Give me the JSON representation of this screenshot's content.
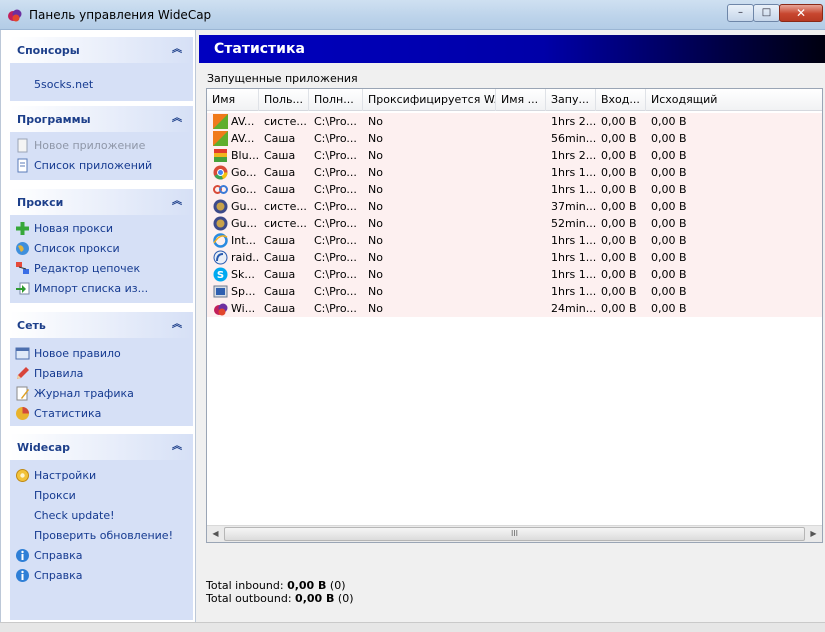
{
  "window": {
    "title": "Панель управления WideCap",
    "min_label": "–",
    "max_label": "□",
    "close_label": "✕"
  },
  "sidebar": {
    "groups": [
      {
        "title": "Спонсоры",
        "items": [
          {
            "label": "5socks.net"
          }
        ]
      },
      {
        "title": "Программы",
        "items": [
          {
            "label": "Новое приложение",
            "icon": "new-app-icon"
          },
          {
            "label": "Список приложений",
            "icon": "app-list-icon"
          }
        ]
      },
      {
        "title": "Прокси",
        "items": [
          {
            "label": "Новая прокси",
            "icon": "plus-icon"
          },
          {
            "label": "Список прокси",
            "icon": "globe-icon"
          },
          {
            "label": "Редактор цепочек",
            "icon": "chain-editor-icon"
          },
          {
            "label": "Импорт списка из...",
            "icon": "import-icon"
          }
        ]
      },
      {
        "title": "Сеть",
        "items": [
          {
            "label": "Новое правило",
            "icon": "new-rule-icon"
          },
          {
            "label": "Правила",
            "icon": "pencil-icon"
          },
          {
            "label": "Журнал трафика",
            "icon": "log-icon"
          },
          {
            "label": "Статистика",
            "icon": "pie-chart-icon"
          }
        ]
      },
      {
        "title": "Widecap",
        "items": [
          {
            "label": "Настройки",
            "icon": "gear-icon"
          },
          {
            "label": "Прокси"
          },
          {
            "label": "Check update!"
          },
          {
            "label": "Проверить обновление!"
          },
          {
            "label": "Справка",
            "icon": "help-icon"
          },
          {
            "label": "Справка",
            "icon": "help-icon"
          }
        ]
      }
    ]
  },
  "main": {
    "title": "Статистика",
    "section_label": "Запущенные приложения",
    "columns": [
      "Имя",
      "Поль...",
      "Полн...",
      "Проксифицируется W...",
      "Имя ...",
      "Запу...",
      "Вход...",
      "Исходящий"
    ],
    "rows": [
      {
        "icon": "avast-icon",
        "cells": [
          "AV...",
          "систе...",
          "C:\\Pro...",
          "No",
          "",
          "1hrs 2...",
          "0,00 B",
          "0,00 B"
        ]
      },
      {
        "icon": "avast-icon",
        "cells": [
          "AV...",
          "Саша",
          "C:\\Pro...",
          "No",
          "",
          "56min...",
          "0,00 B",
          "0,00 B"
        ]
      },
      {
        "icon": "bluestacks-icon",
        "cells": [
          "Blu...",
          "Саша",
          "C:\\Pro...",
          "No",
          "",
          "1hrs 2...",
          "0,00 B",
          "0,00 B"
        ]
      },
      {
        "icon": "chrome-icon",
        "cells": [
          "Go...",
          "Саша",
          "C:\\Pro...",
          "No",
          "",
          "1hrs 1...",
          "0,00 B",
          "0,00 B"
        ]
      },
      {
        "icon": "google-update-icon",
        "cells": [
          "Go...",
          "Саша",
          "C:\\Pro...",
          "No",
          "",
          "1hrs 1...",
          "0,00 B",
          "0,00 B"
        ]
      },
      {
        "icon": "guard-icon",
        "cells": [
          "Gu...",
          "систе...",
          "C:\\Pro...",
          "No",
          "",
          "37min...",
          "0,00 B",
          "0,00 B"
        ]
      },
      {
        "icon": "guard-icon",
        "cells": [
          "Gu...",
          "систе...",
          "C:\\Pro...",
          "No",
          "",
          "52min...",
          "0,00 B",
          "0,00 B"
        ]
      },
      {
        "icon": "ie-icon",
        "cells": [
          "Int...",
          "Саша",
          "C:\\Pro...",
          "No",
          "",
          "1hrs 1...",
          "0,00 B",
          "0,00 B"
        ]
      },
      {
        "icon": "raidcall-icon",
        "cells": [
          "raid...",
          "Саша",
          "C:\\Pro...",
          "No",
          "",
          "1hrs 1...",
          "0,00 B",
          "0,00 B"
        ]
      },
      {
        "icon": "skype-icon",
        "cells": [
          "Sk...",
          "Саша",
          "C:\\Pro...",
          "No",
          "",
          "1hrs 1...",
          "0,00 B",
          "0,00 B"
        ]
      },
      {
        "icon": "speedfan-icon",
        "cells": [
          "Sp...",
          "Саша",
          "C:\\Pro...",
          "No",
          "",
          "1hrs 1...",
          "0,00 B",
          "0,00 B"
        ]
      },
      {
        "icon": "widecap-icon",
        "cells": [
          "Wi...",
          "Саша",
          "C:\\Pro...",
          "No",
          "",
          "24min...",
          "0,00 B",
          "0,00 B"
        ]
      }
    ],
    "scroll_thumb_label": "III",
    "totals": {
      "inbound_label": "Total inbound:",
      "inbound_value": "0,00 B",
      "inbound_count": "(0)",
      "outbound_label": "Total outbound:",
      "outbound_value": "0,00 B",
      "outbound_count": "(0)"
    }
  },
  "colors": {
    "header_blue": "#0000c0",
    "link_blue": "#153a90",
    "row_tint": "#fdf0f0",
    "group_bg": "#d6e0f6"
  }
}
